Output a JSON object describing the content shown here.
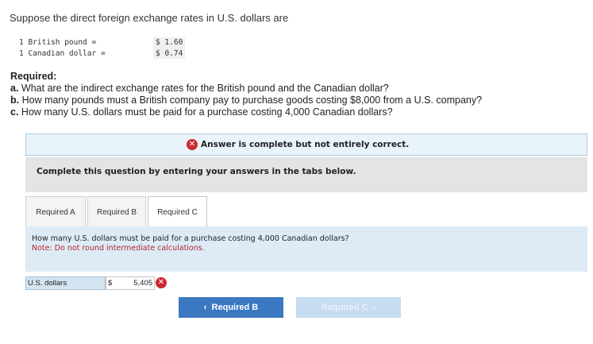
{
  "intro": "Suppose the direct foreign exchange rates in U.S. dollars are",
  "rates": [
    {
      "name": "1 British pound =",
      "value": "$ 1.60"
    },
    {
      "name": "1 Canadian dollar =",
      "value": "$ 0.74"
    }
  ],
  "required": {
    "title": "Required:",
    "items": [
      {
        "letter": "a.",
        "text": "What are the indirect exchange rates for the British pound and the Canadian dollar?"
      },
      {
        "letter": "b.",
        "text": "How many pounds must a British company pay to purchase goods costing $8,000 from a U.S. company?"
      },
      {
        "letter": "c.",
        "text": "How many U.S. dollars must be paid for a purchase costing 4,000 Canadian dollars?"
      }
    ]
  },
  "alert": {
    "text": "Answer is complete but not entirely correct.",
    "icon": "x-circle-icon",
    "color": "#cc2a32"
  },
  "instructions": "Complete this question by entering your answers in the tabs below.",
  "tabs": [
    {
      "label": "Required A"
    },
    {
      "label": "Required B"
    },
    {
      "label": "Required C",
      "active": true
    }
  ],
  "panel": {
    "question": "How many U.S. dollars must be paid for a purchase costing 4,000 Canadian dollars?",
    "note": "Note: Do not round intermediate calculations."
  },
  "answer": {
    "label": "U.S. dollars",
    "currency": "$",
    "value": "5,405",
    "status": "incorrect"
  },
  "nav": {
    "prev": "Required B",
    "next": "Required C",
    "prev_icon": "chevron-left-icon",
    "next_icon": "chevron-right-icon"
  },
  "colors": {
    "accent": "#3b78c2",
    "error": "#cc2a32",
    "panel": "#dcebf6"
  }
}
